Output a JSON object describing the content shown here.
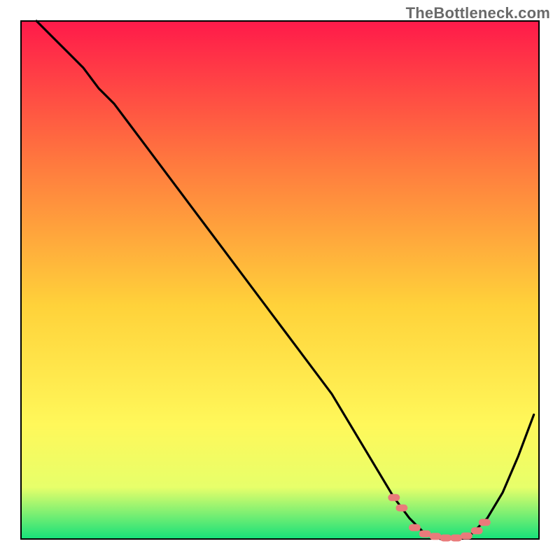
{
  "watermark": "TheBottleneck.com",
  "colors": {
    "gradient_top": "#ff1a4a",
    "gradient_mid_upper": "#ff7b3e",
    "gradient_mid": "#ffd23a",
    "gradient_mid_lower": "#fff85a",
    "gradient_low": "#e7ff6a",
    "gradient_bottom": "#15e07a",
    "curve": "#000000",
    "marker_fill": "#e97b7b",
    "marker_stroke": "#e97b7b",
    "frame": "#000000"
  },
  "chart_data": {
    "type": "line",
    "title": "",
    "xlabel": "",
    "ylabel": "",
    "xlim": [
      0,
      100
    ],
    "ylim": [
      0,
      100
    ],
    "series": [
      {
        "name": "bottleneck-curve",
        "x": [
          3,
          6,
          9,
          12,
          15,
          18,
          21,
          24,
          27,
          30,
          33,
          36,
          39,
          42,
          45,
          48,
          51,
          54,
          57,
          60,
          63,
          66,
          69,
          72,
          75,
          78,
          81,
          84,
          87,
          90,
          93,
          96,
          99
        ],
        "y": [
          100,
          97,
          94,
          91,
          87,
          84,
          80,
          76,
          72,
          68,
          64,
          60,
          56,
          52,
          48,
          44,
          40,
          36,
          32,
          28,
          23,
          18,
          13,
          8,
          4,
          1,
          0,
          0,
          1,
          4,
          9,
          16,
          24
        ]
      }
    ],
    "markers": {
      "name": "optimal-range-markers",
      "x": [
        72,
        73.5,
        76,
        78,
        80,
        82,
        84,
        86,
        88,
        89.5
      ],
      "y": [
        8,
        6,
        2.2,
        1,
        0.5,
        0.2,
        0.2,
        0.6,
        1.6,
        3.2
      ]
    }
  }
}
